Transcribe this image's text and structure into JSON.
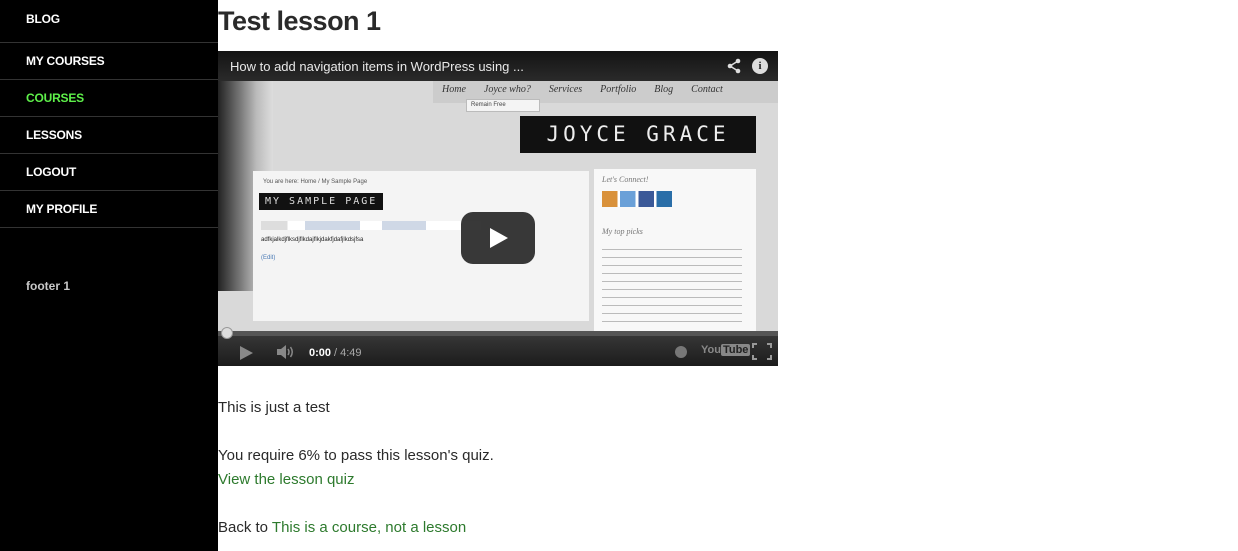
{
  "sidebar": {
    "items": [
      {
        "label": "BLOG",
        "active": false
      },
      {
        "label": "MY COURSES",
        "active": false
      },
      {
        "label": "COURSES",
        "active": true
      },
      {
        "label": "LESSONS",
        "active": false
      },
      {
        "label": "LOGOUT",
        "active": false
      },
      {
        "label": "MY PROFILE",
        "active": false
      }
    ],
    "footer": "footer 1"
  },
  "main": {
    "title": "Test lesson 1",
    "video": {
      "title": "How to add navigation items in WordPress using ...",
      "current_time": "0:00",
      "total_time": "/ 4:49",
      "progress": 0,
      "youtube_label": "You",
      "youtube_tube": "Tube",
      "thumbnail": {
        "menu": [
          "Home",
          "Joyce who?",
          "Services",
          "Portfolio",
          "Blog",
          "Contact"
        ],
        "submenu": "Remain Free",
        "brand": "JOYCE GRACE",
        "breadcrumb": "You are here: Home / My Sample Page",
        "heading": "MY SAMPLE PAGE",
        "body_text": "adfkjalkdjflksdjflkdajflkjdakfjdafjlkdsjfsa",
        "edit": "(Edit)",
        "side_heading_1": "Let's Connect!",
        "side_heading_2": "My top picks"
      }
    },
    "intro_text": "This is just a test",
    "quiz_requirement": "You require 6% to pass this lesson's quiz.",
    "quiz_link": "View the lesson quiz",
    "back_prefix": "Back to ",
    "back_link": "This is a course, not a lesson"
  },
  "colors": {
    "sidebar_bg": "#000000",
    "active_nav": "#5ef04a",
    "link": "#2d7a2d",
    "text": "#2a2a2a"
  }
}
